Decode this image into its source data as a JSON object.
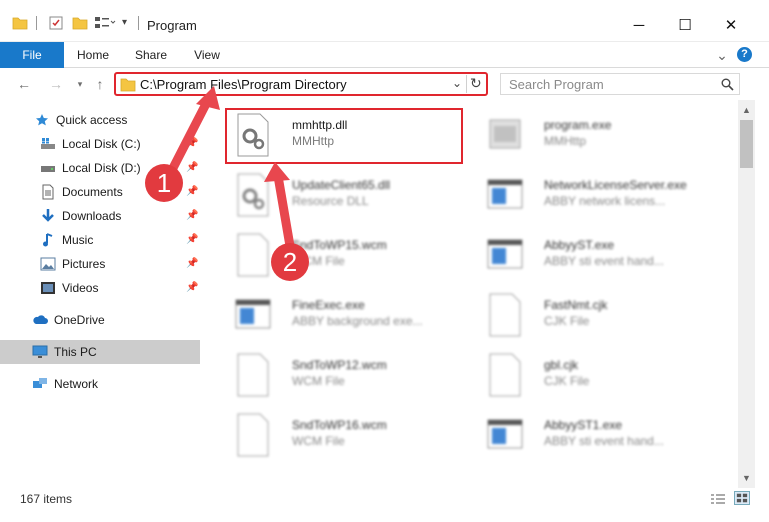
{
  "window": {
    "title": "Program",
    "minimize": "─",
    "maximize": "☐",
    "close": "✕"
  },
  "ribbon": {
    "tabs": [
      "File",
      "Home",
      "Share",
      "View"
    ],
    "expand": "⌄",
    "help": "?"
  },
  "address": {
    "path": "C:\\Program Files\\Program Directory",
    "search_placeholder": "Search Program"
  },
  "sidebar": {
    "items": [
      {
        "label": "Quick access",
        "icon": "star-icon",
        "pinned": false
      },
      {
        "label": "Local Disk (C:)",
        "icon": "windows-drive-icon",
        "pinned": true
      },
      {
        "label": "Local Disk (D:)",
        "icon": "drive-icon",
        "pinned": true
      },
      {
        "label": "Documents",
        "icon": "documents-icon",
        "pinned": true
      },
      {
        "label": "Downloads",
        "icon": "download-icon",
        "pinned": true
      },
      {
        "label": "Music",
        "icon": "music-icon",
        "pinned": true
      },
      {
        "label": "Pictures",
        "icon": "pictures-icon",
        "pinned": true
      },
      {
        "label": "Videos",
        "icon": "videos-icon",
        "pinned": true
      },
      {
        "label": "OneDrive",
        "icon": "cloud-icon",
        "pinned": false
      },
      {
        "label": "This PC",
        "icon": "monitor-icon",
        "pinned": false,
        "selected": true
      },
      {
        "label": "Network",
        "icon": "network-icon",
        "pinned": false
      }
    ]
  },
  "files": [
    {
      "name": "mmhttp.dll",
      "type": "MMHttp",
      "icon": "dll-gear-icon",
      "highlighted": true
    },
    {
      "name": "program.exe",
      "type": "MMHttp",
      "icon": "exe-icon"
    },
    {
      "name": "UpdateClient65.dll",
      "type": "Resource DLL",
      "icon": "dll-gear-icon"
    },
    {
      "name": "NetworkLicenseServer.exe",
      "type": "ABBY network licens...",
      "icon": "exe-window-icon"
    },
    {
      "name": "SndToWP15.wcm",
      "type": "WCM File",
      "icon": "blank-file-icon"
    },
    {
      "name": "AbbyyST.exe",
      "type": "ABBY sti event hand...",
      "icon": "exe-window-icon"
    },
    {
      "name": "FineExec.exe",
      "type": "ABBY background exe...",
      "icon": "exe-window-icon"
    },
    {
      "name": "FastNmt.cjk",
      "type": "CJK File",
      "icon": "blank-file-icon"
    },
    {
      "name": "SndToWP12.wcm",
      "type": "WCM File",
      "icon": "blank-file-icon"
    },
    {
      "name": "gbl.cjk",
      "type": "CJK File",
      "icon": "blank-file-icon"
    },
    {
      "name": "SndToWP16.wcm",
      "type": "WCM File",
      "icon": "blank-file-icon"
    },
    {
      "name": "AbbyyST1.exe",
      "type": "ABBY sti event hand...",
      "icon": "exe-window-icon"
    }
  ],
  "status": {
    "count": "167 items"
  },
  "annotations": {
    "badge1": "1",
    "badge2": "2"
  },
  "colors": {
    "accent": "#1979ca",
    "highlight_red": "#e0262e",
    "folder_yellow": "#f4c542"
  }
}
